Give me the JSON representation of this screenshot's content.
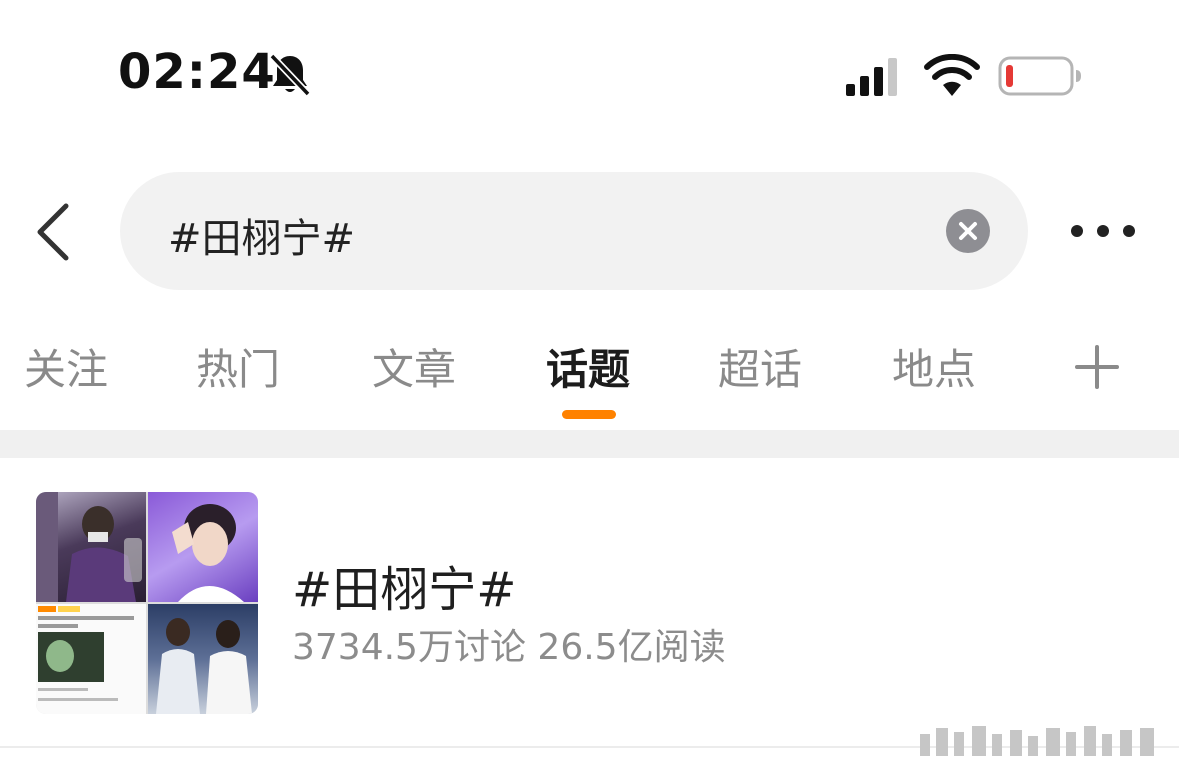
{
  "status_bar": {
    "time": "02:24",
    "icons": [
      "bell-slash-icon",
      "cellular-signal-icon",
      "wifi-icon",
      "battery-low-icon"
    ],
    "battery_color": "#e53935"
  },
  "search": {
    "query": "#田栩宁#",
    "back_icon": "chevron-left-icon",
    "clear_icon": "clear-circle-icon",
    "more_icon": "more-dots-icon"
  },
  "tabs": {
    "items": [
      {
        "label": "关注",
        "active": false
      },
      {
        "label": "热门",
        "active": false
      },
      {
        "label": "文章",
        "active": false
      },
      {
        "label": "话题",
        "active": true
      },
      {
        "label": "超话",
        "active": false
      },
      {
        "label": "地点",
        "active": false
      }
    ],
    "add_icon": "plus-icon",
    "accent_color": "#ff8200"
  },
  "topic": {
    "title": "#田栩宁#",
    "stats": "3734.5万讨论 26.5亿阅读"
  }
}
